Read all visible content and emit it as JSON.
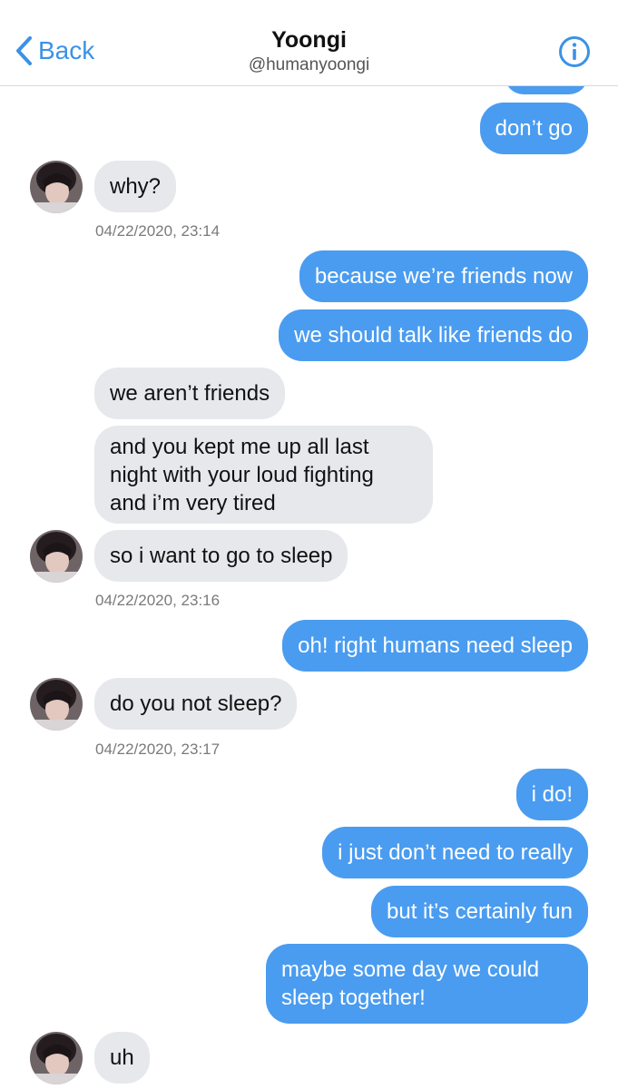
{
  "header": {
    "back_label": "Back",
    "title": "Yoongi",
    "handle": "@humanyoongi"
  },
  "colors": {
    "accent": "#3b92e6",
    "outgoing_bubble": "#4a9cf0",
    "incoming_bubble": "#e6e8ec"
  },
  "messages": [
    {
      "dir": "out",
      "text": "don’t go"
    },
    {
      "dir": "in",
      "text": "why?"
    },
    {
      "dir": "ts",
      "text": "04/22/2020, 23:14"
    },
    {
      "dir": "out",
      "text": "because we’re friends now"
    },
    {
      "dir": "out",
      "text": "we should talk like friends do"
    },
    {
      "dir": "in",
      "text": "we aren’t friends"
    },
    {
      "dir": "in",
      "lines": [
        "and you kept me up all last",
        "night with your loud fighting",
        "and i’m very tired"
      ]
    },
    {
      "dir": "in",
      "text": "so i want to go to sleep"
    },
    {
      "dir": "ts",
      "text": "04/22/2020, 23:16"
    },
    {
      "dir": "out",
      "text": "oh! right humans need sleep"
    },
    {
      "dir": "in",
      "text": "do you not sleep?"
    },
    {
      "dir": "ts",
      "text": "04/22/2020, 23:17"
    },
    {
      "dir": "out",
      "text": "i do!"
    },
    {
      "dir": "out",
      "text": "i just don’t need to really"
    },
    {
      "dir": "out",
      "text": "but it’s certainly fun"
    },
    {
      "dir": "out",
      "lines": [
        "maybe some day we could",
        "sleep together!"
      ]
    },
    {
      "dir": "in",
      "text": "uh"
    }
  ]
}
